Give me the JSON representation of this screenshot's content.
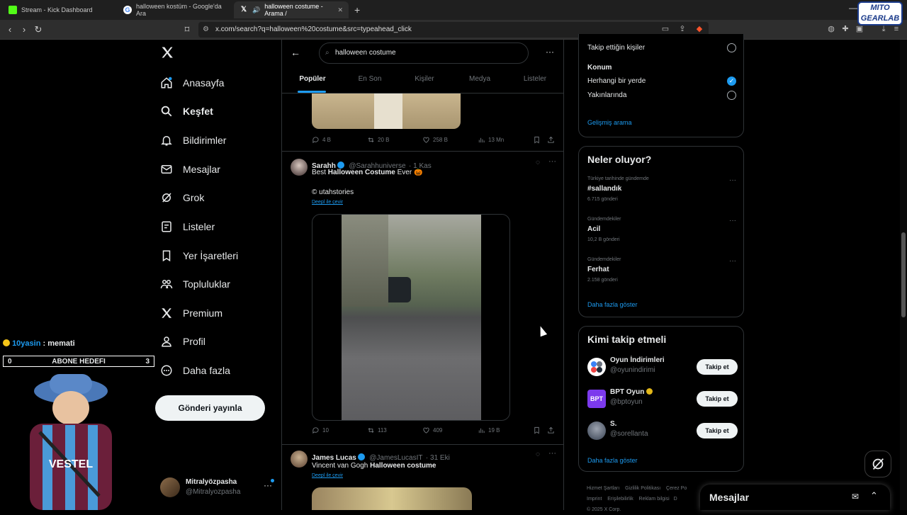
{
  "browser": {
    "tabs": [
      {
        "label": "Stream - Kick Dashboard",
        "icon": "kick-icon"
      },
      {
        "label": "halloween kostüm - Google'da Ara",
        "icon": "google-icon"
      },
      {
        "label": "halloween costume - Arama /",
        "icon": "x-icon"
      }
    ],
    "url": "x.com/search?q=halloween%20costume&src=typeahead_click",
    "watermark": "MITO GEARLAB"
  },
  "nav": {
    "items": [
      {
        "label": "Anasayfa",
        "icon": "home-icon"
      },
      {
        "label": "Keşfet",
        "icon": "search-icon"
      },
      {
        "label": "Bildirimler",
        "icon": "bell-icon"
      },
      {
        "label": "Mesajlar",
        "icon": "mail-icon"
      },
      {
        "label": "Grok",
        "icon": "grok-icon"
      },
      {
        "label": "Listeler",
        "icon": "list-icon"
      },
      {
        "label": "Yer İşaretleri",
        "icon": "bookmark-icon"
      },
      {
        "label": "Topluluklar",
        "icon": "communities-icon"
      },
      {
        "label": "Premium",
        "icon": "x-logo-icon"
      },
      {
        "label": "Profil",
        "icon": "person-icon"
      },
      {
        "label": "Daha fazla",
        "icon": "more-circle-icon"
      }
    ],
    "post_button": "Gönderi yayınla",
    "profile": {
      "name": "Mitralyözpasha",
      "handle": "@Mitralyozpasha"
    }
  },
  "stream_overlay": {
    "chat_user": "10yasin",
    "chat_message": ": memati",
    "goal_label": "ABONE HEDEFI",
    "goal_current": "0",
    "goal_target": "3"
  },
  "search": {
    "query": "halloween costume",
    "tabs": [
      "Popüler",
      "En Son",
      "Kişiler",
      "Medya",
      "Listeler"
    ]
  },
  "posts": [
    {
      "stats": {
        "replies": "4 B",
        "reposts": "20 B",
        "likes": "258 B",
        "views": "13 Mn"
      }
    },
    {
      "name": "Sarahh",
      "handle": "@Sarahhuniverse",
      "time": "· 1 Kas",
      "text_pre": "Best ",
      "text_bold": "Halloween Costume",
      "text_post": " Ever 🎃",
      "credit": "© utahstories",
      "translate": "Deepl ile çevir",
      "stats": {
        "replies": "10",
        "reposts": "113",
        "likes": "409",
        "views": "19 B"
      }
    },
    {
      "name": "James Lucas",
      "handle": "@JamesLucasIT",
      "time": "· 31 Eki",
      "text_pre": "Vincent van Gogh ",
      "text_bold": "Halloween costume",
      "translate": "Deepl ile çevir"
    }
  ],
  "filters": {
    "following_label": "Takip ettiğin kişiler",
    "location_title": "Konum",
    "anywhere_label": "Herhangi bir yerde",
    "nearby_label": "Yakınlarında",
    "advanced_link": "Gelişmiş arama"
  },
  "trends": {
    "title": "Neler oluyor?",
    "items": [
      {
        "context": "Türkiye tarihinde gündemde",
        "name": "#sallandık",
        "count": "6.715 gönderi"
      },
      {
        "context": "Gündemdekiler",
        "name": "Acil",
        "count": "10,2 B gönderi"
      },
      {
        "context": "Gündemdekiler",
        "name": "Ferhat",
        "count": "2.158 gönderi"
      }
    ],
    "show_more": "Daha fazla göster"
  },
  "who_to_follow": {
    "title": "Kimi takip etmeli",
    "items": [
      {
        "name": "Oyun İndirimleri",
        "handle": "@oyunindirimi",
        "button": "Takip et"
      },
      {
        "name": "BPT Oyun",
        "handle": "@bptoyun",
        "button": "Takip et"
      },
      {
        "name": "S.",
        "handle": "@sorellanta",
        "button": "Takip et"
      }
    ],
    "show_more": "Daha fazla göster"
  },
  "footer": {
    "links": [
      "Hizmet Şartları",
      "Gizlilik Politikası",
      "Çerez Po",
      "Imprint",
      "Erişilebilirlik",
      "Reklam bilgisi",
      "D"
    ],
    "copyright": "© 2025 X Corp."
  },
  "messages_drawer": {
    "title": "Mesajlar"
  },
  "colors": {
    "accent": "#1d9bf0",
    "background": "#000000",
    "border": "#2f3336"
  }
}
